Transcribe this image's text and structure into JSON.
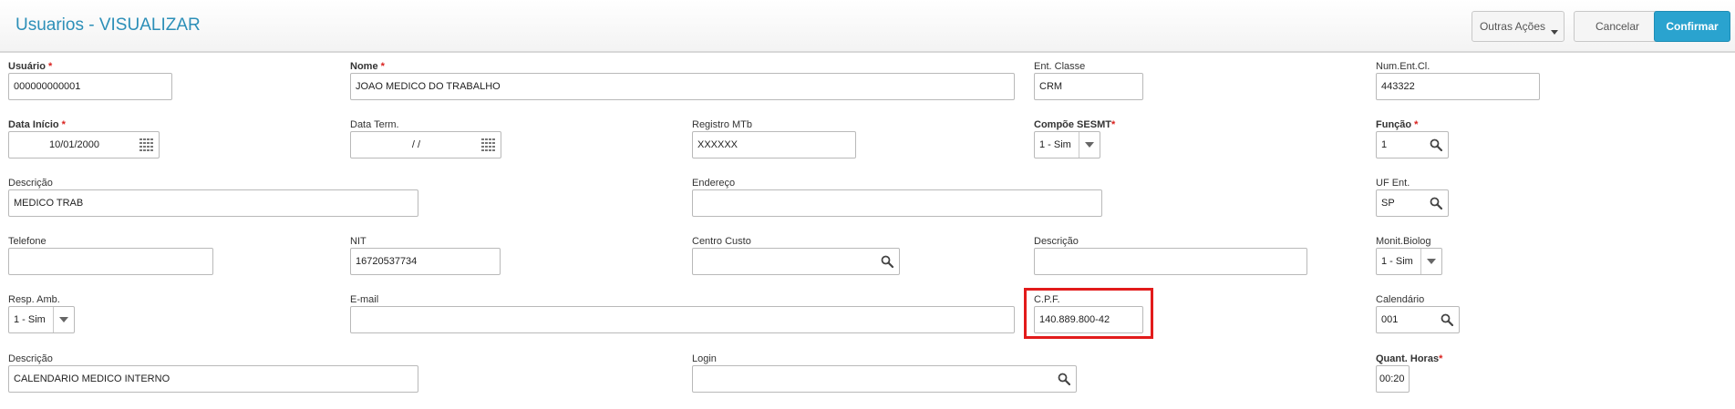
{
  "header": {
    "title": "Usuarios - VISUALIZAR",
    "outras_acoes": "Outras Ações",
    "cancelar": "Cancelar",
    "confirmar": "Confirmar"
  },
  "fields": {
    "usuario": {
      "label": "Usuário",
      "value": "000000000001",
      "required": "*"
    },
    "nome": {
      "label": "Nome",
      "value": "JOAO MEDICO DO TRABALHO",
      "required": "*"
    },
    "ent_classe": {
      "label": "Ent. Classe",
      "value": "CRM"
    },
    "num_ent_cl": {
      "label": "Num.Ent.Cl.",
      "value": "443322"
    },
    "data_inicio": {
      "label": "Data Início",
      "value": "10/01/2000",
      "required": "*"
    },
    "data_term": {
      "label": "Data Term.",
      "value": "/ /"
    },
    "registro_mtb": {
      "label": "Registro MTb",
      "value": "XXXXXX"
    },
    "compoe_sesmt": {
      "label": "Compõe SESMT",
      "value": "1 - Sim",
      "required": "*"
    },
    "funcao": {
      "label": "Função",
      "value": "1",
      "required": "*"
    },
    "descricao1": {
      "label": "Descrição",
      "value": "MEDICO TRAB"
    },
    "endereco": {
      "label": "Endereço",
      "value": ""
    },
    "uf_ent": {
      "label": "UF Ent.",
      "value": "SP"
    },
    "telefone": {
      "label": "Telefone",
      "value": ""
    },
    "nit": {
      "label": "NIT",
      "value": "16720537734"
    },
    "centro_custo": {
      "label": "Centro Custo",
      "value": ""
    },
    "descricao2": {
      "label": "Descrição",
      "value": ""
    },
    "monit_biolog": {
      "label": "Monit.Biolog",
      "value": "1 - Sim"
    },
    "resp_amb": {
      "label": "Resp. Amb.",
      "value": "1 - Sim"
    },
    "email": {
      "label": "E-mail",
      "value": ""
    },
    "cpf": {
      "label": "C.P.F.",
      "value": "140.889.800-42"
    },
    "calendario": {
      "label": "Calendário",
      "value": "001"
    },
    "descricao3": {
      "label": "Descrição",
      "value": "CALENDARIO MEDICO INTERNO"
    },
    "login": {
      "label": "Login",
      "value": ""
    },
    "quant_horas": {
      "label": "Quant. Horas",
      "value": "00:20",
      "required": "*"
    }
  },
  "colors": {
    "accent": "#2c8fb8",
    "primary_button": "#2aa3cf",
    "required": "#d9211e",
    "highlight": "#e21b1b"
  },
  "icons": {
    "search": "search-icon",
    "calendar": "calendar-icon",
    "dropdown": "chevron-down-icon"
  }
}
